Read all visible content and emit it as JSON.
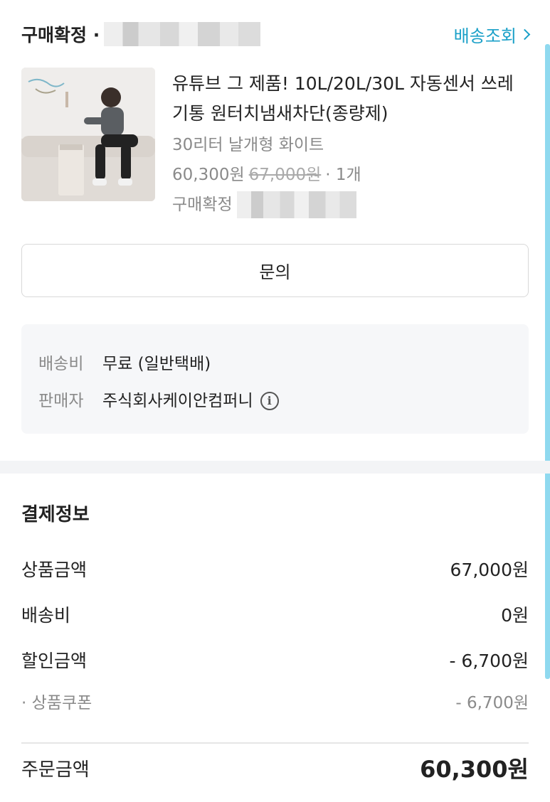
{
  "header": {
    "status": "구매확정 ·",
    "track_label": "배송조회"
  },
  "product": {
    "name": "유튜브 그 제품! 10L/20L/30L 자동센서 쓰레기통 원터치냄새차단(종량제)",
    "option": "30리터 날개형 화이트",
    "price": "60,300원",
    "original_price": "67,000원",
    "quantity": "· 1개",
    "confirm_label": "구매확정"
  },
  "inquiry_button": "문의",
  "delivery": {
    "fee_label": "배송비",
    "fee_value": "무료 (일반택배)",
    "seller_label": "판매자",
    "seller_value": "주식회사케이안컴퍼니"
  },
  "payment": {
    "title": "결제정보",
    "rows": [
      {
        "label": "상품금액",
        "value": "67,000원"
      },
      {
        "label": "배송비",
        "value": "0원"
      },
      {
        "label": "할인금액",
        "value": "- 6,700원"
      },
      {
        "label": "· 상품쿠폰",
        "value": "- 6,700원"
      }
    ],
    "total_label": "주문금액",
    "total_value": "60,300원"
  },
  "colors": {
    "accent": "#1aa0c8",
    "muted_text": "#8a8a8a",
    "panel_bg": "#f6f7f9"
  }
}
